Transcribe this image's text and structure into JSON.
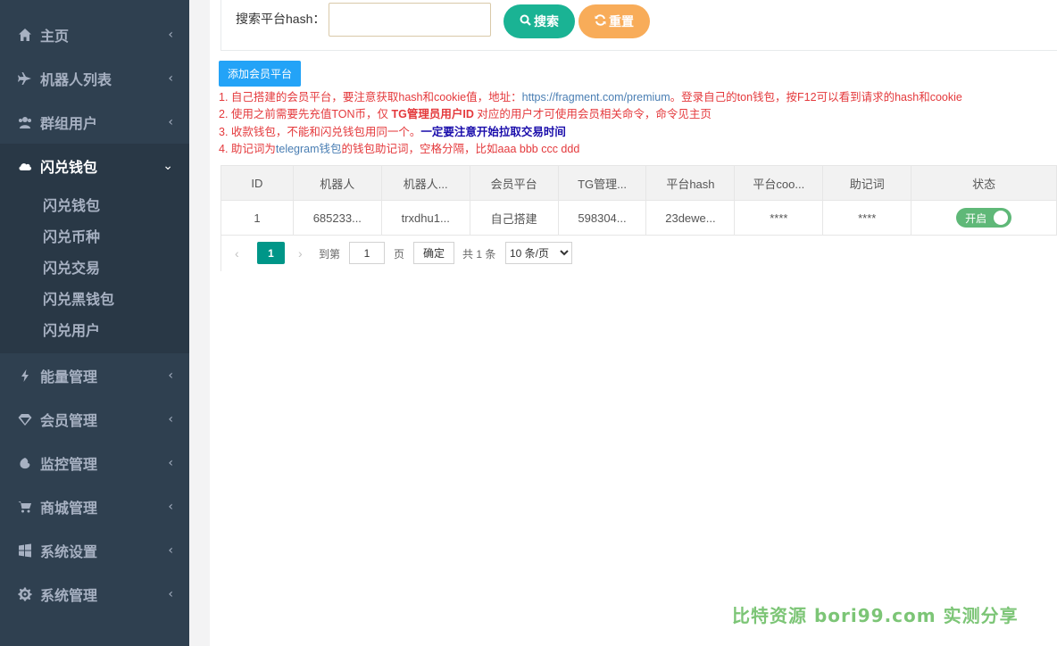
{
  "sidebar": {
    "items": [
      {
        "label": "主页",
        "icon": "home-icon"
      },
      {
        "label": "机器人列表",
        "icon": "plane-icon"
      },
      {
        "label": "群组用户",
        "icon": "users-icon"
      },
      {
        "label": "闪兑钱包",
        "icon": "cloud-icon"
      },
      {
        "label": "能量管理",
        "icon": "bolt-icon"
      },
      {
        "label": "会员管理",
        "icon": "diamond-icon"
      },
      {
        "label": "监控管理",
        "icon": "monitor-icon"
      },
      {
        "label": "商城管理",
        "icon": "cart-icon"
      },
      {
        "label": "系统设置",
        "icon": "windows-icon"
      },
      {
        "label": "系统管理",
        "icon": "gear-icon"
      }
    ],
    "submenu": [
      "闪兑钱包",
      "闪兑币种",
      "闪兑交易",
      "闪兑黑钱包",
      "闪兑用户"
    ],
    "chevron_collapsed": "‹",
    "chevron_expanded": "⌄"
  },
  "search": {
    "label": "搜索平台hash：",
    "value": "",
    "search_button": "搜索",
    "reset_button": "重置"
  },
  "add_button": "添加会员平台",
  "notes": {
    "line1_a": "1. 自己搭建的会员平台，要注意获取hash和cookie值，地址：",
    "line1_link": "https://fragment.com/premium",
    "line1_b": "。登录自己的ton钱包，按F12可以看到请求的hash和cookie",
    "line2_a": "2. 使用之前需要先充值TON币，仅 ",
    "line2_bold": "TG管理员用户ID",
    "line2_b": " 对应的用户才可使用会员相关命令，命令见主页",
    "line3_a": "3. 收款钱包，不能和闪兑钱包用同一个。",
    "line3_bold": "一定要注意开始拉取交易时间",
    "line4_a": "4. 助记词为",
    "line4_link": "telegram钱包",
    "line4_b": "的钱包助记词，空格分隔，比如aaa bbb ccc ddd"
  },
  "table": {
    "headers": [
      "ID",
      "机器人",
      "机器人...",
      "会员平台",
      "TG管理...",
      "平台hash",
      "平台coo...",
      "助记词",
      "状态"
    ],
    "rows": [
      {
        "id": "1",
        "bot": "685233...",
        "bot_name": "trxdhu1...",
        "platform": "自己搭建",
        "tg_admin": "598304...",
        "hash": "23dewe...",
        "cookie": "****",
        "mnemonic": "****",
        "status": "开启"
      }
    ]
  },
  "pager": {
    "prev": "‹",
    "next": "›",
    "current_page": "1",
    "goto_label": "到第",
    "goto_value": "1",
    "page_unit": "页",
    "confirm": "确定",
    "total": "共 1 条",
    "page_size": "10 条/页"
  },
  "watermark": "比特资源 bori99.com 实测分享"
}
